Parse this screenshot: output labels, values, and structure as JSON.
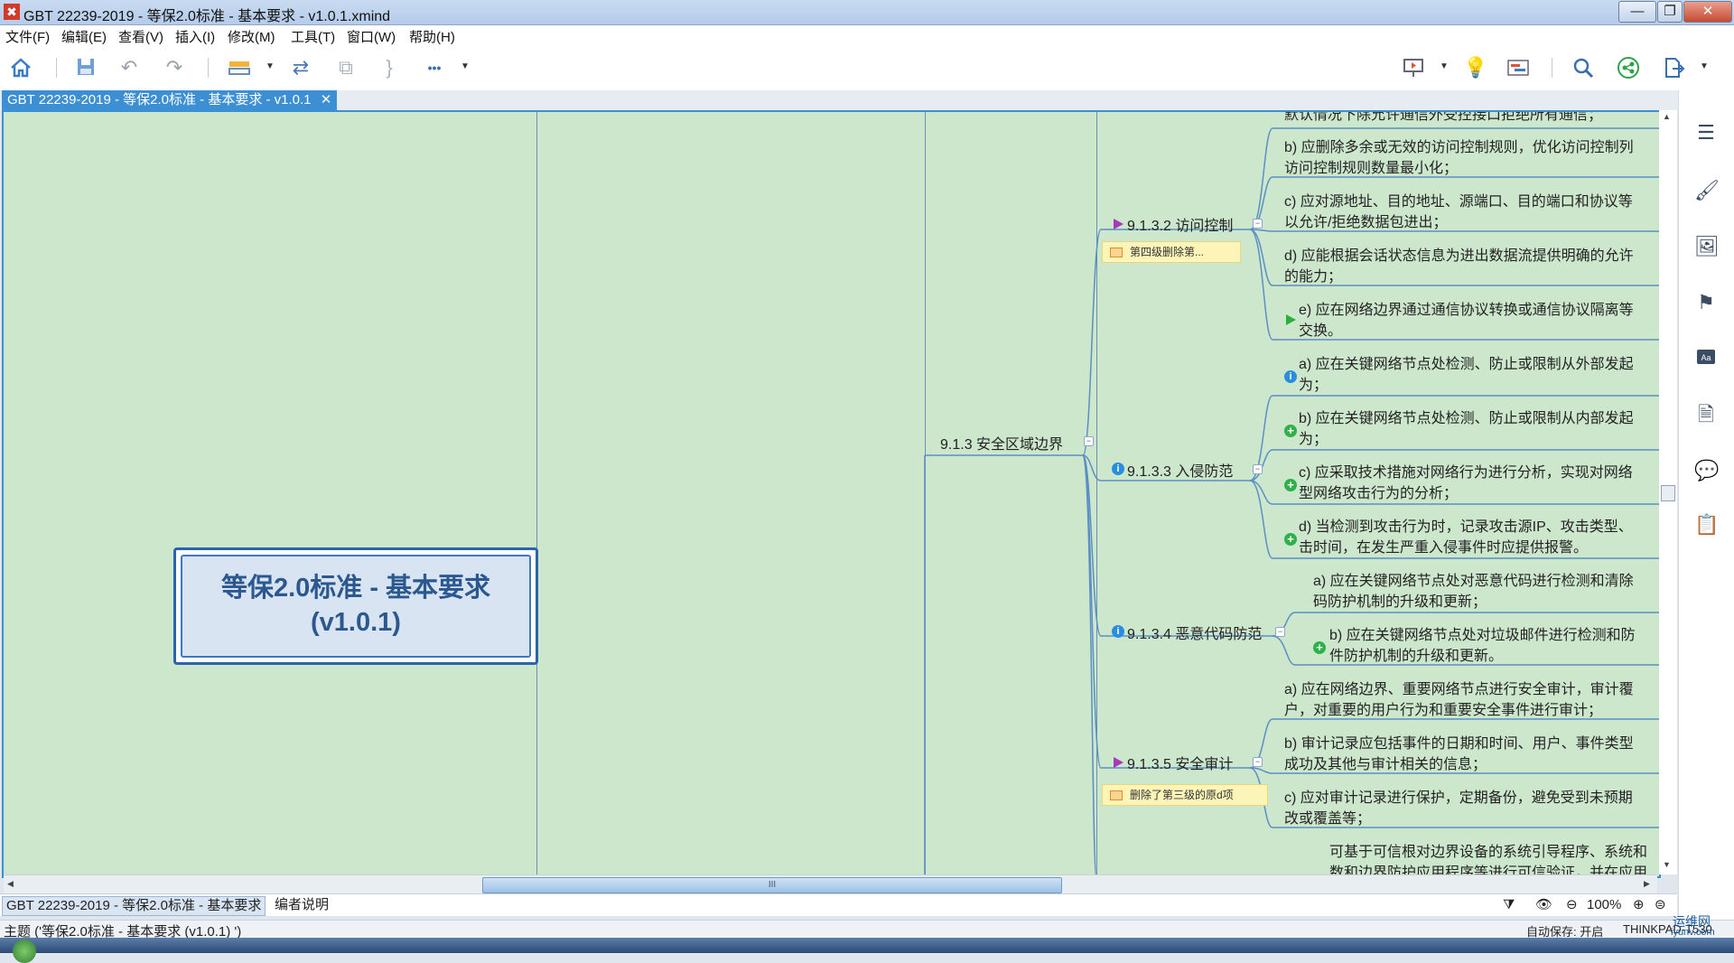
{
  "window": {
    "title": "GBT 22239-2019 - 等保2.0标准 - 基本要求 - v1.0.1.xmind",
    "logo": "✖",
    "buttons": {
      "minimize": "—",
      "maximize": "❐",
      "close": "✕"
    }
  },
  "menu": [
    "文件(F)",
    "编辑(E)",
    "查看(V)",
    "插入(I)",
    "修改(M)",
    "工具(T)",
    "窗口(W)",
    "帮助(H)"
  ],
  "toolbar": {
    "icons": [
      "home-icon",
      "save-icon",
      "undo-icon",
      "redo-icon",
      "topic-icon",
      "relationship-icon",
      "boundary-icon",
      "summary-icon",
      "more-icon",
      "presentation-icon",
      "idea-icon",
      "gantt-icon",
      "search-icon",
      "share-icon",
      "export-icon"
    ],
    "more_glyph": "•••"
  },
  "document_tab": {
    "label": "GBT 22239-2019 - 等保2.0标准 - 基本要求 - v1.0.1",
    "close": "✕"
  },
  "mindmap": {
    "central_topic": {
      "line1": "等保2.0标准 - 基本要求",
      "line2": "(v1.0.1)"
    },
    "main_topic": "9.1.3 安全区域边界",
    "subtopics": [
      {
        "label": "9.1.3.2 访问控制",
        "marker": "flag-purple",
        "note": "第四级删除第..."
      },
      {
        "label": "9.1.3.3 入侵防范",
        "marker": "info"
      },
      {
        "label": "9.1.3.4 恶意代码防范",
        "marker": "info"
      },
      {
        "label": "9.1.3.5 安全审计",
        "marker": "flag-purple",
        "note": "删除了第三级的原d项"
      }
    ],
    "items": [
      {
        "lines": [
          "默认情况下除允许通信外受控接口拒绝所有通信；"
        ],
        "marker": ""
      },
      {
        "lines": [
          "b) 应删除多余或无效的访问控制规则，优化访问控制列",
          "访问控制规则数量最小化；"
        ],
        "marker": ""
      },
      {
        "lines": [
          "c) 应对源地址、目的地址、源端口、目的端口和协议等",
          "以允许/拒绝数据包进出；"
        ],
        "marker": ""
      },
      {
        "lines": [
          "d) 应能根据会话状态信息为进出数据流提供明确的允许",
          "的能力；"
        ],
        "marker": ""
      },
      {
        "lines": [
          "e) 应在网络边界通过通信协议转换或通信协议隔离等",
          "交换。"
        ],
        "marker": "flag-green"
      },
      {
        "lines": [
          "a) 应在关键网络节点处检测、防止或限制从外部发起",
          "为；"
        ],
        "marker": "info"
      },
      {
        "lines": [
          "b) 应在关键网络节点处检测、防止或限制从内部发起",
          "为；"
        ],
        "marker": "plus"
      },
      {
        "lines": [
          "c) 应采取技术措施对网络行为进行分析，实现对网络",
          "型网络攻击行为的分析；"
        ],
        "marker": "plus"
      },
      {
        "lines": [
          "d) 当检测到攻击行为时，记录攻击源IP、攻击类型、",
          "击时间，在发生严重入侵事件时应提供报警。"
        ],
        "marker": "plus"
      },
      {
        "lines": [
          "a) 应在关键网络节点处对恶意代码进行检测和清除",
          "码防护机制的升级和更新；"
        ],
        "marker": ""
      },
      {
        "lines": [
          "b) 应在关键网络节点处对垃圾邮件进行检测和防",
          "件防护机制的升级和更新。"
        ],
        "marker": "plus"
      },
      {
        "lines": [
          "a) 应在网络边界、重要网络节点进行安全审计，审计覆",
          "户，对重要的用户行为和重要安全事件进行审计；"
        ],
        "marker": ""
      },
      {
        "lines": [
          "b) 审计记录应包括事件的日期和时间、用户、事件类型",
          "成功及其他与审计相关的信息；"
        ],
        "marker": ""
      },
      {
        "lines": [
          "c) 应对审计记录进行保护，定期备份，避免受到未预期",
          "改或覆盖等；"
        ],
        "marker": ""
      },
      {
        "lines": [
          "可基于可信根对边界设备的系统引导程序、系统和",
          "数和边界防护应用程序等进行可信验证，并在应用"
        ],
        "marker": ""
      }
    ]
  },
  "scrollbar": {
    "thumb_glyph": "III"
  },
  "sheets": [
    "GBT 22239-2019 - 等保2.0标准 - 基本要求",
    "编者说明"
  ],
  "status": {
    "left": "主题 ('等保2.0标准 - 基本要求 (v1.0.1) ')",
    "zoom": "100%",
    "autosave": "自动保存: 开启",
    "computer": "THINKPAD-T530"
  },
  "watermark": {
    "line1": "运维网",
    "line2": "iyunv.com"
  },
  "right_panel": [
    "outline-icon",
    "format-icon",
    "image-icon",
    "marker-icon",
    "font-icon",
    "notes-icon",
    "comment-icon",
    "task-icon"
  ],
  "colors": {
    "canvas": "#cde7cd",
    "accent": "#3d8fd4",
    "central_text": "#2c5890",
    "flag": "#a63ab7"
  }
}
